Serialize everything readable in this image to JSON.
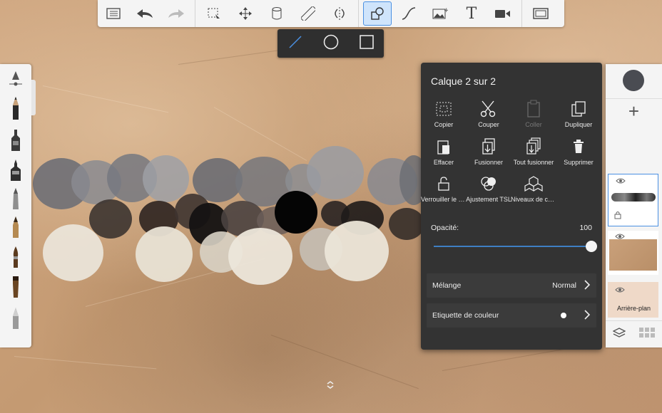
{
  "app": {
    "background_color": "#c9a07a",
    "accent_color": "#4a90e2"
  },
  "toolbar": {
    "items": [
      "list-icon",
      "undo-icon",
      "redo-icon",
      "selection-icon",
      "transform-icon",
      "fill-icon",
      "ruler-icon",
      "symmetry-icon",
      "shape-icon",
      "stroke-icon",
      "image-icon",
      "text-icon",
      "video-icon",
      "fullscreen-icon"
    ],
    "text_tool_label": "T",
    "active_tool": "shape-icon"
  },
  "shape_toolbar": {
    "items": [
      "line-icon",
      "circle-icon",
      "square-icon"
    ]
  },
  "brushes": [
    "pencil",
    "marker",
    "airbrush",
    "paint-brush",
    "fineliner",
    "pen",
    "ink-brush",
    "flat-brush",
    "soft-pencil"
  ],
  "layer_dialog": {
    "title": "Calque 2 sur 2",
    "actions": [
      {
        "label": "Copier",
        "icon": "copy-selection-icon",
        "enabled": true
      },
      {
        "label": "Couper",
        "icon": "scissors-icon",
        "enabled": true
      },
      {
        "label": "Coller",
        "icon": "paste-icon",
        "enabled": false
      },
      {
        "label": "Dupliquer",
        "icon": "duplicate-icon",
        "enabled": true
      },
      {
        "label": "Effacer",
        "icon": "clear-icon",
        "enabled": true
      },
      {
        "label": "Fusionner",
        "icon": "merge-icon",
        "enabled": true
      },
      {
        "label": "Tout fusionner",
        "icon": "merge-all-icon",
        "enabled": true
      },
      {
        "label": "Supprimer",
        "icon": "trash-icon",
        "enabled": true
      },
      {
        "label": "Verrouiller le c...",
        "icon": "lock-icon",
        "enabled": true
      },
      {
        "label": "Ajustement TSL",
        "icon": "hsl-icon",
        "enabled": true
      },
      {
        "label": "Niveaux de co...",
        "icon": "levels-icon",
        "enabled": true
      }
    ],
    "opacity_label": "Opacité:",
    "opacity_value": "100",
    "opacity_fraction": 1.0,
    "blend_label": "Mélange",
    "blend_value": "Normal",
    "color_tag_label": "Etiquette de couleur",
    "color_tag_color": "#ffffff"
  },
  "layer_panel": {
    "current_color": "#4a4c52",
    "add_label": "+",
    "background_label": "Arrière-plan",
    "background_color": "#efd9c8"
  }
}
